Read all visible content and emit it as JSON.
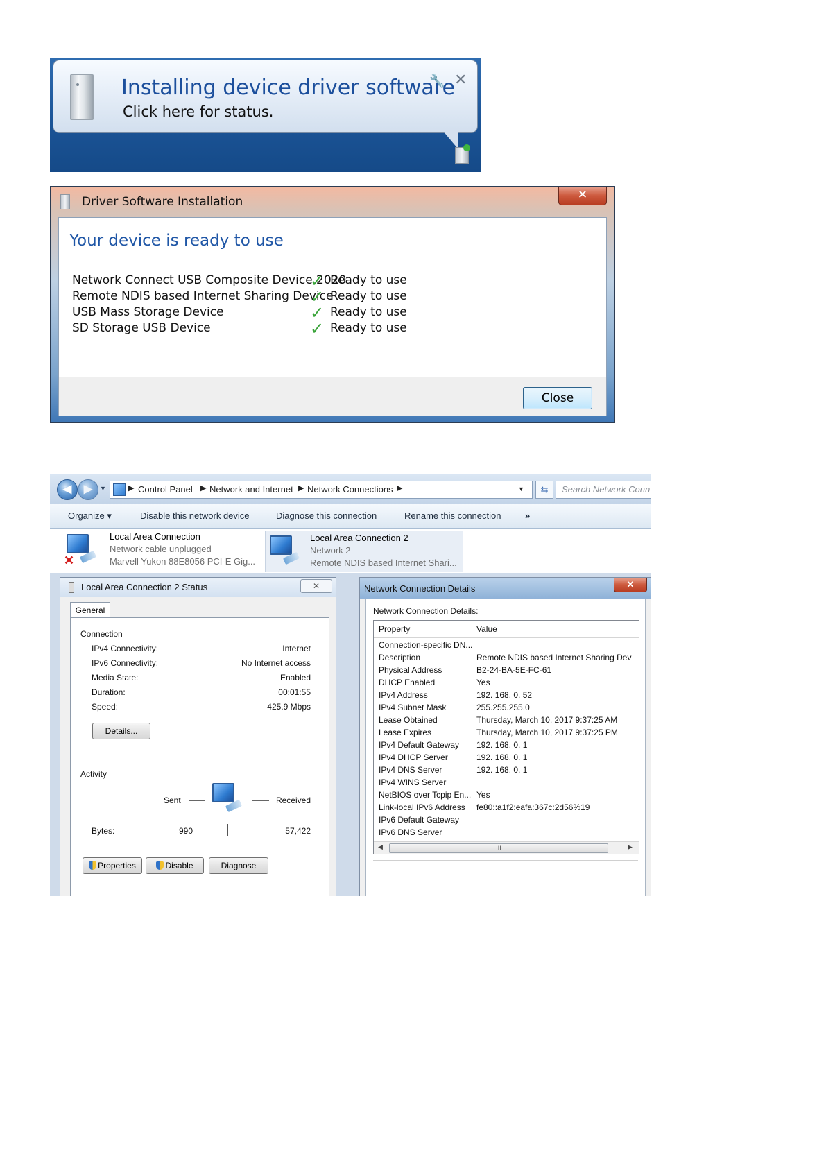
{
  "notification": {
    "title": "Installing device driver software",
    "subtitle": "Click here for status.",
    "close_glyph": "✕",
    "wrench_glyph": "🔧"
  },
  "driver_dialog": {
    "title": "Driver Software Installation",
    "heading": "Your device is ready to use",
    "close_glyph": "✕",
    "devices": [
      {
        "name": "Network Connect USB Composite Device 2020",
        "status": "Ready to use"
      },
      {
        "name": "Remote NDIS based Internet Sharing Device",
        "status": "Ready to use"
      },
      {
        "name": "USB Mass Storage Device",
        "status": "Ready to use"
      },
      {
        "name": "SD Storage USB Device",
        "status": "Ready to use"
      }
    ],
    "close_button": "Close"
  },
  "explorer": {
    "breadcrumb": [
      "Control Panel",
      "Network and Internet",
      "Network Connections"
    ],
    "search_placeholder": "Search Network Conn",
    "toolbar": {
      "organize": "Organize ▾",
      "disable": "Disable this network device",
      "diagnose": "Diagnose this connection",
      "rename": "Rename this connection",
      "more": "»"
    },
    "connections": [
      {
        "name": "Local Area Connection",
        "status": "Network cable unplugged",
        "adapter": "Marvell Yukon 88E8056 PCI-E Gig..."
      },
      {
        "name": "Local Area Connection 2",
        "status": "Network 2",
        "adapter": "Remote NDIS based Internet Shari..."
      }
    ]
  },
  "status_dialog": {
    "title": "Local Area Connection 2 Status",
    "tab": "General",
    "connection_group": "Connection",
    "rows": [
      {
        "label": "IPv4 Connectivity:",
        "value": "Internet"
      },
      {
        "label": "IPv6 Connectivity:",
        "value": "No Internet access"
      },
      {
        "label": "Media State:",
        "value": "Enabled"
      },
      {
        "label": "Duration:",
        "value": "00:01:55"
      },
      {
        "label": "Speed:",
        "value": "425.9 Mbps"
      }
    ],
    "details_button": "Details...",
    "activity_group": "Activity",
    "sent_label": "Sent",
    "received_label": "Received",
    "bytes_label": "Bytes:",
    "bytes_sent": "990",
    "bytes_received": "57,422",
    "buttons": {
      "properties": "Properties",
      "disable": "Disable",
      "diagnose": "Diagnose"
    }
  },
  "details_dialog": {
    "title": "Network Connection Details",
    "label": "Network Connection Details:",
    "columns": [
      "Property",
      "Value"
    ],
    "rows": [
      [
        "Connection-specific DN...",
        ""
      ],
      [
        "Description",
        "Remote NDIS based Internet Sharing Dev"
      ],
      [
        "Physical Address",
        "B2-24-BA-5E-FC-61"
      ],
      [
        "DHCP Enabled",
        "Yes"
      ],
      [
        "IPv4 Address",
        "192. 168. 0. 52"
      ],
      [
        "IPv4 Subnet Mask",
        "255.255.255.0"
      ],
      [
        "Lease Obtained",
        "Thursday, March 10, 2017 9:37:25 AM"
      ],
      [
        "Lease Expires",
        "Thursday, March 10, 2017 9:37:25 PM"
      ],
      [
        "IPv4 Default Gateway",
        "192. 168. 0. 1"
      ],
      [
        "IPv4 DHCP Server",
        "192. 168. 0. 1"
      ],
      [
        "IPv4 DNS Server",
        "192. 168. 0. 1"
      ],
      [
        "IPv4 WINS Server",
        ""
      ],
      [
        "NetBIOS over Tcpip En...",
        "Yes"
      ],
      [
        "Link-local IPv6 Address",
        "fe80::a1f2:eafa:367c:2d56%19"
      ],
      [
        "IPv6 Default Gateway",
        ""
      ],
      [
        "IPv6 DNS Server",
        ""
      ]
    ],
    "scroll_thumb": "III"
  }
}
